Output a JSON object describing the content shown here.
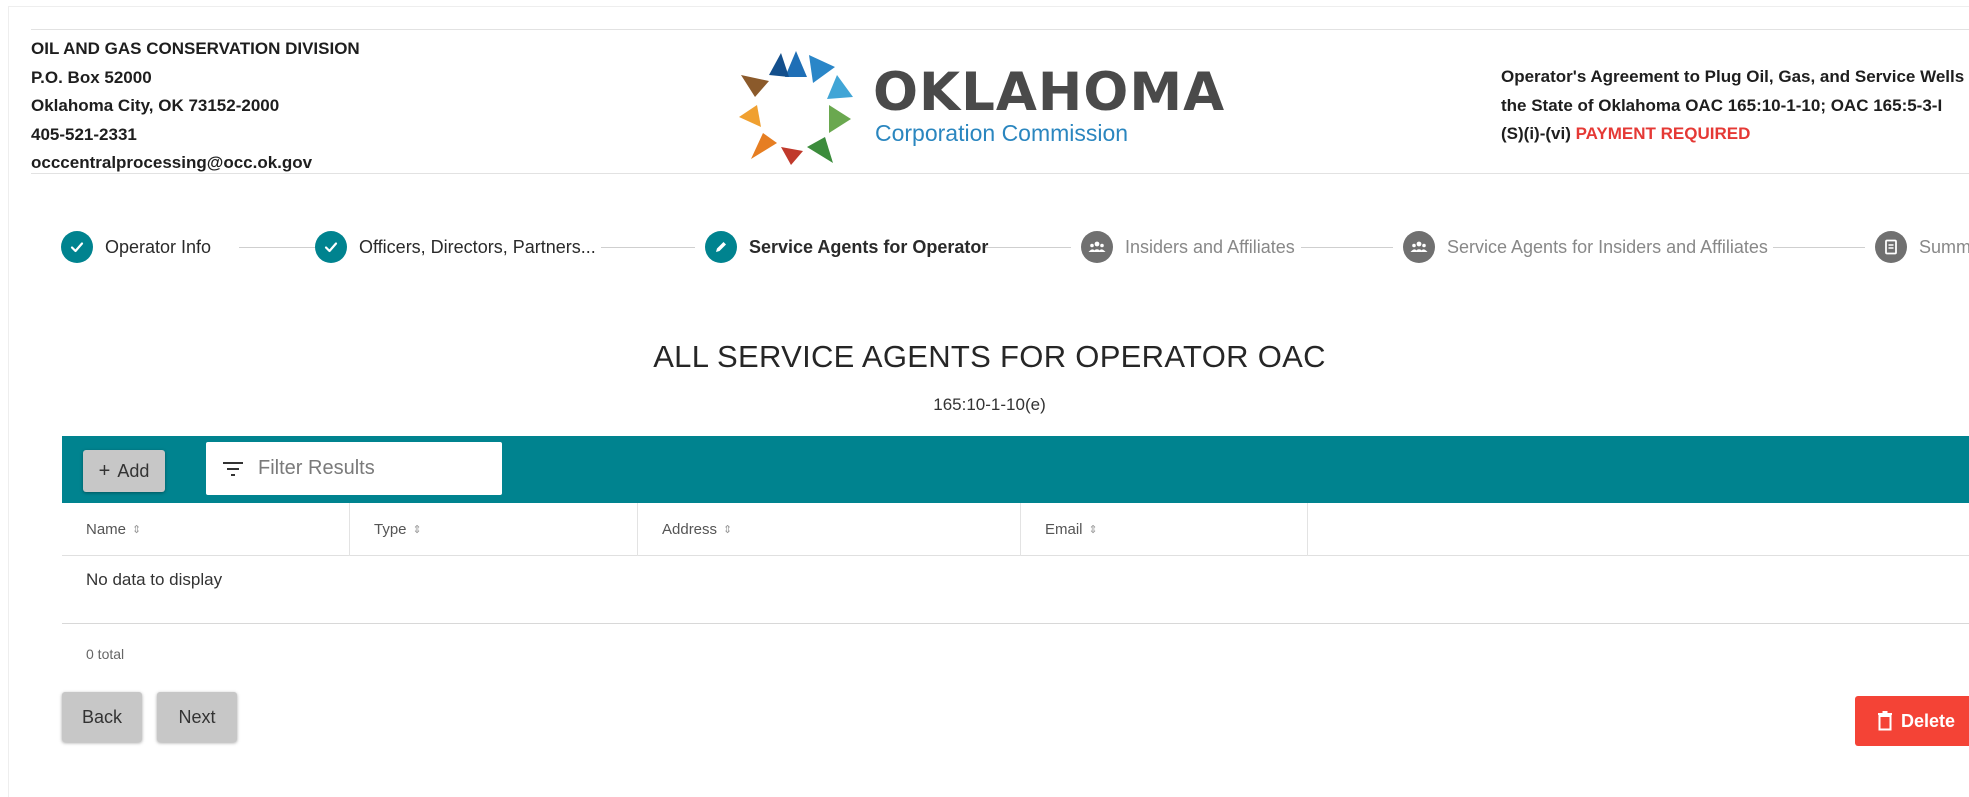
{
  "header": {
    "org_lines": [
      "OIL AND GAS CONSERVATION DIVISION",
      "P.O. Box 52000",
      "Oklahoma City, OK 73152-2000",
      "405-521-2331",
      "occcentralprocessing@occ.ok.gov"
    ],
    "logo": {
      "wordmark": "OKLAHOMA",
      "subtitle": "Corporation Commission",
      "icon": "oklahoma-star-logo"
    },
    "agreement_lines": [
      "Operator's Agreement to Plug Oil, Gas, and Service Wells",
      "the State of Oklahoma OAC 165:10-1-10; OAC 165:5-3-I",
      "(S)(i)-(vi)"
    ],
    "payment_required": "PAYMENT REQUIRED"
  },
  "stepper": {
    "steps": [
      {
        "label": "Operator Info",
        "state": "done",
        "icon": "check-icon"
      },
      {
        "label": "Officers, Directors, Partners...",
        "state": "done",
        "icon": "check-icon"
      },
      {
        "label": "Service Agents for Operator",
        "state": "active",
        "icon": "pencil-icon"
      },
      {
        "label": "Insiders and Affiliates",
        "state": "pending",
        "icon": "group-icon"
      },
      {
        "label": "Service Agents for Insiders and Affiliates",
        "state": "pending",
        "icon": "group-icon"
      },
      {
        "label": "Summ",
        "state": "pending",
        "icon": "document-icon"
      }
    ]
  },
  "page": {
    "title": "ALL SERVICE AGENTS FOR OPERATOR OAC",
    "subtitle": "165:10-1-10(e)"
  },
  "toolbar": {
    "add_label": "Add",
    "filter_placeholder": "Filter Results",
    "filter_value": ""
  },
  "table": {
    "columns": [
      "Name",
      "Type",
      "Address",
      "Email",
      ""
    ],
    "empty_text": "No data to display",
    "total_text": "0 total"
  },
  "footer": {
    "back_label": "Back",
    "next_label": "Next",
    "delete_label": "Delete"
  },
  "colors": {
    "accent": "#00838f",
    "danger": "#f44336",
    "payment_required": "#e53935",
    "button_gray": "#c7c7c7"
  }
}
